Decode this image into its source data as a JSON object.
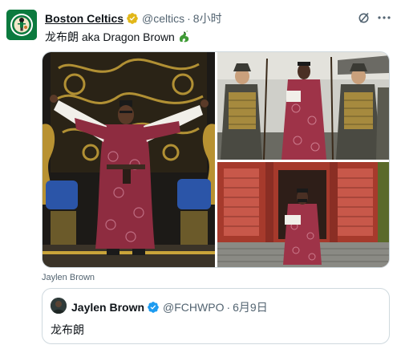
{
  "tweet": {
    "display_name": "Boston Celtics",
    "handle": "@celtics",
    "separator": "·",
    "time": "8小时",
    "text": "龙布朗 aka Dragon Brown",
    "emoji": "dragon-emoji",
    "tagged_user": "Jaylen Brown",
    "icons": [
      "celtics-logo",
      "verified-badge-gold",
      "grok-icon",
      "more-icon",
      "dragon-emoji"
    ]
  },
  "quoted": {
    "display_name": "Jaylen Brown",
    "handle": "@FCHWPO",
    "separator": "·",
    "time": "6月9日",
    "text": "龙布朗",
    "icons": [
      "avatar",
      "verified-badge-blue"
    ]
  },
  "colors": {
    "celtics_green": "#0b7a3e",
    "verified_gold": "#e2b719",
    "verified_blue": "#1d9bf0",
    "secondary_text": "#536471",
    "border": "#cfd9de"
  }
}
